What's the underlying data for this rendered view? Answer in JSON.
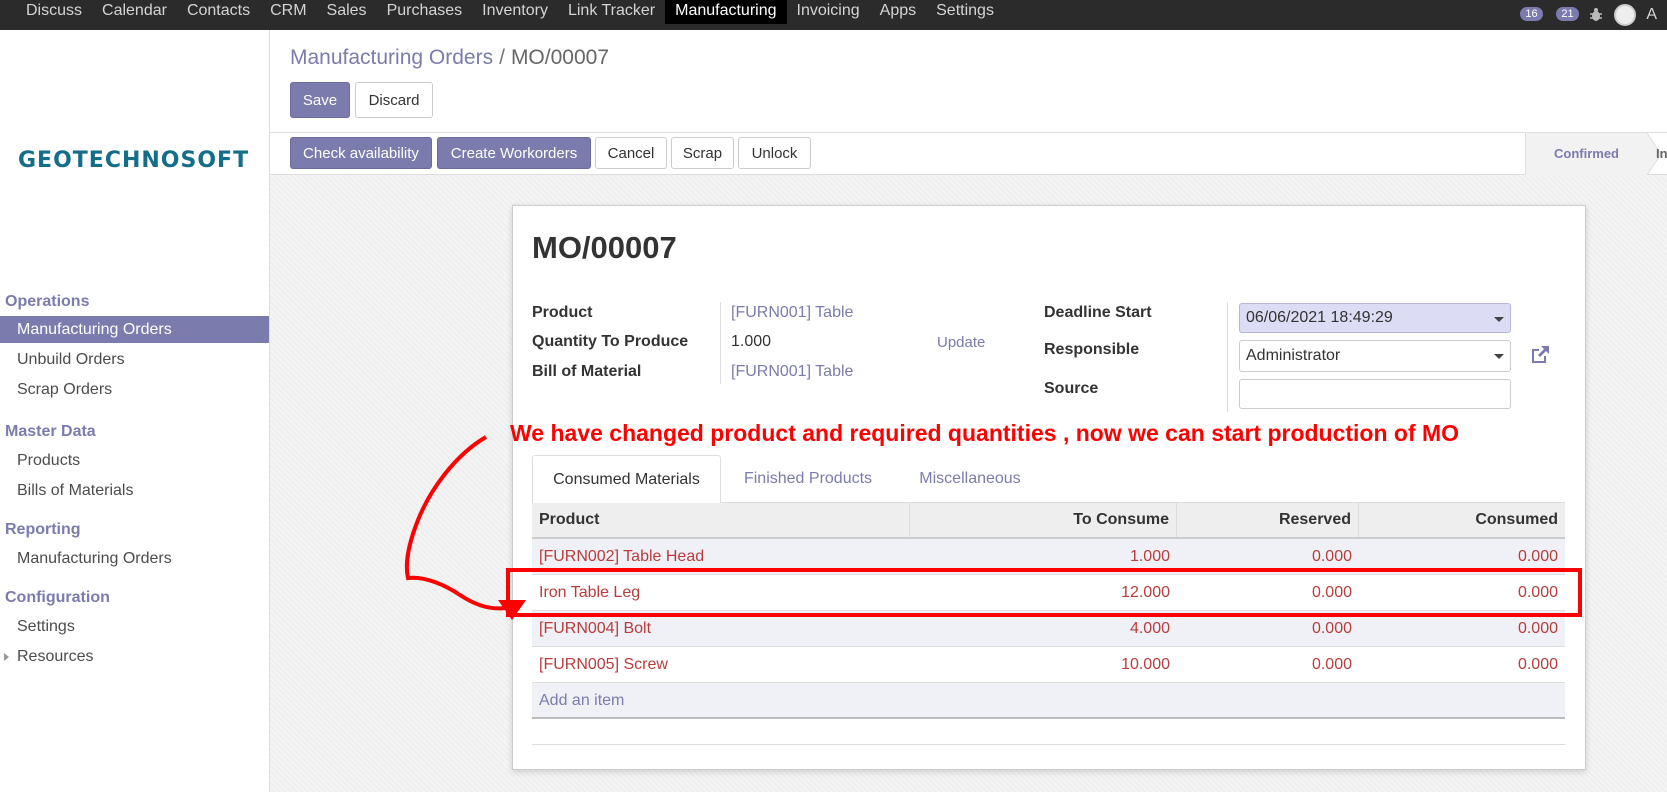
{
  "topnav": {
    "items": [
      "Discuss",
      "Calendar",
      "Contacts",
      "CRM",
      "Sales",
      "Purchases",
      "Inventory",
      "Link Tracker",
      "Manufacturing",
      "Invoicing",
      "Apps",
      "Settings"
    ],
    "active": "Manufacturing",
    "activities_count": "16",
    "messages_count": "21",
    "user_initial": "A"
  },
  "sidebar": {
    "logo": "GEOTECHNOSOFT",
    "sections": [
      {
        "title": "Operations",
        "items": [
          "Manufacturing Orders",
          "Unbuild Orders",
          "Scrap Orders"
        ]
      },
      {
        "title": "Master Data",
        "items": [
          "Products",
          "Bills of Materials"
        ]
      },
      {
        "title": "Reporting",
        "items": [
          "Manufacturing Orders"
        ]
      },
      {
        "title": "Configuration",
        "items": [
          "Settings",
          "Resources"
        ]
      }
    ]
  },
  "breadcrumb": {
    "parent": "Manufacturing Orders",
    "separator": "/",
    "current": "MO/00007"
  },
  "buttons": {
    "save": "Save",
    "discard": "Discard",
    "check_availability": "Check availability",
    "create_workorders": "Create Workorders",
    "cancel": "Cancel",
    "scrap": "Scrap",
    "unlock": "Unlock"
  },
  "status": {
    "confirmed": "Confirmed",
    "next": "In"
  },
  "form": {
    "title": "MO/00007",
    "product_label": "Product",
    "product_value": "[FURN001] Table",
    "qty_label": "Quantity To Produce",
    "qty_value": "1.000",
    "update_link": "Update",
    "bom_label": "Bill of Material",
    "bom_value": "[FURN001] Table",
    "deadline_label": "Deadline Start",
    "deadline_value": "06/06/2021 18:49:29",
    "responsible_label": "Responsible",
    "responsible_value": "Administrator",
    "source_label": "Source",
    "source_value": ""
  },
  "annotation": "We have changed product and required quantities , now we can start production of MO",
  "tabs": [
    "Consumed Materials",
    "Finished Products",
    "Miscellaneous"
  ],
  "table": {
    "headers": [
      "Product",
      "To Consume",
      "Reserved",
      "Consumed"
    ],
    "rows": [
      [
        "[FURN002] Table Head",
        "1.000",
        "0.000",
        "0.000"
      ],
      [
        "Iron Table Leg",
        "12.000",
        "0.000",
        "0.000"
      ],
      [
        "[FURN004] Bolt",
        "4.000",
        "0.000",
        "0.000"
      ],
      [
        "[FURN005] Screw",
        "10.000",
        "0.000",
        "0.000"
      ]
    ],
    "add_item": "Add an item"
  },
  "colors": {
    "accent": "#7c7bad",
    "annotation": "#ff0000",
    "row_text": "#b83c3c"
  }
}
